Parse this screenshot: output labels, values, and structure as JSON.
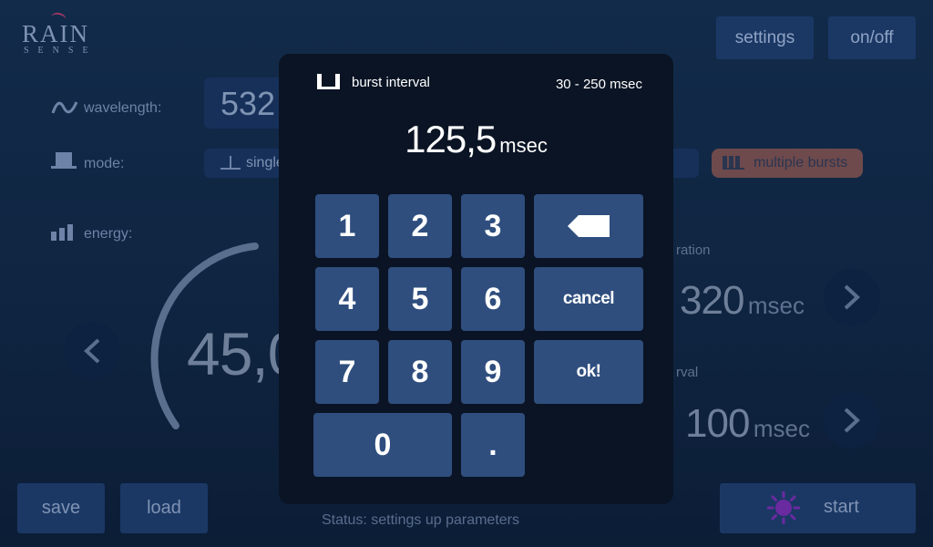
{
  "logo": {
    "word": "RAIN",
    "sub": "SENSE"
  },
  "header": {
    "settings_label": "settings",
    "onoff_label": "on/off"
  },
  "params": {
    "wavelength": {
      "label": "wavelength:",
      "value": "532"
    },
    "mode": {
      "label": "mode:",
      "single_label": "single",
      "multiple_label": "multiple bursts"
    },
    "energy": {
      "label": "energy:",
      "value": "45,0"
    }
  },
  "right": {
    "duration": {
      "label": "ration",
      "value": "320",
      "unit": "msec"
    },
    "interval": {
      "label": "rval",
      "value": "100",
      "unit": "msec"
    }
  },
  "footer": {
    "save_label": "save",
    "load_label": "load",
    "start_label": "start",
    "status_text": "Status: settings up parameters"
  },
  "modal": {
    "title": "burst  interval",
    "range": "30 - 250 msec",
    "value": "125,5",
    "unit": "msec",
    "keys": {
      "k1": "1",
      "k2": "2",
      "k3": "3",
      "k4": "4",
      "k5": "5",
      "k6": "6",
      "k7": "7",
      "k8": "8",
      "k9": "9",
      "k0": "0",
      "dot": ".",
      "cancel": "cancel",
      "ok": "ok!"
    }
  },
  "colors": {
    "background": "#122b4a",
    "modal_bg": "#0a1424",
    "key_bg": "#2f4e7e",
    "start_icon": "#6a2aa0",
    "multiple_bursts_bg": "#6e4a4c"
  },
  "icons": {
    "wavelength": "wave-icon",
    "mode": "pulse-icon",
    "energy": "bars-icon",
    "backspace": "backspace-icon",
    "start": "sun-icon"
  }
}
